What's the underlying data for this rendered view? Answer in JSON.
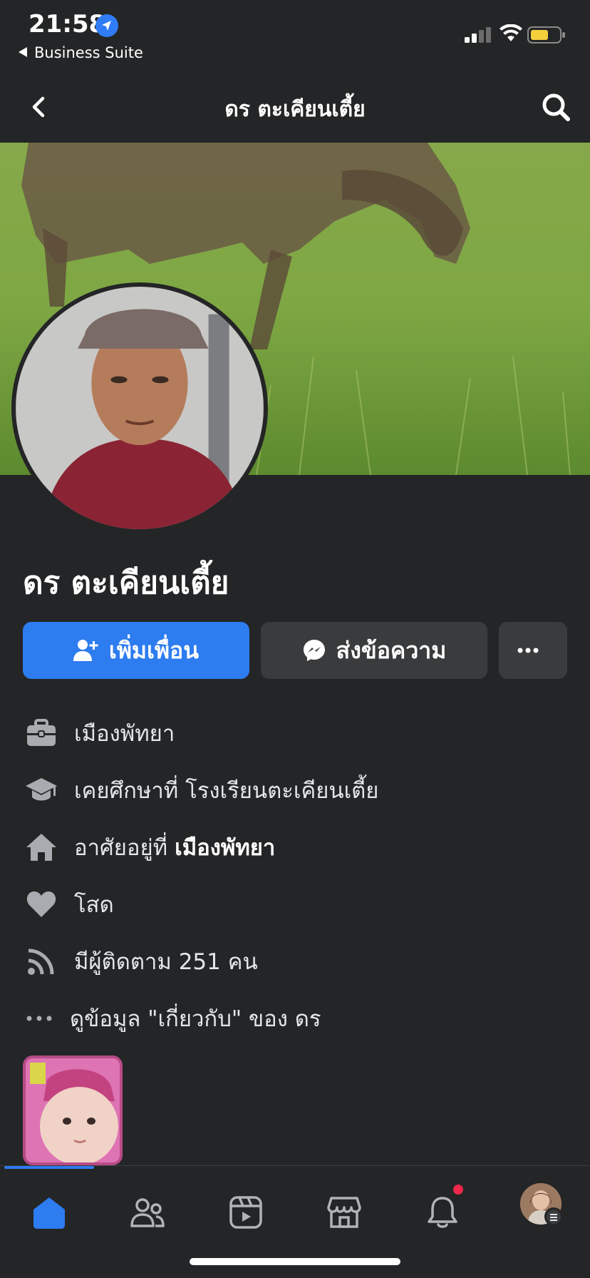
{
  "status_bar": {
    "time": "21:58",
    "back_app_label": "Business Suite"
  },
  "nav": {
    "title": "ดร ตะเคียนเตี้ย"
  },
  "profile": {
    "name": "ดร ตะเคียนเตี้ย"
  },
  "actions": {
    "add_friend_label": "เพิ่มเพื่อน",
    "message_label": "ส่งข้อความ",
    "more_label": "•••"
  },
  "info": {
    "work": "เมืองพัทยา",
    "education": "เคยศึกษาที่ โรงเรียนตะเคียนเตี้ย",
    "lives_in_prefix": "อาศัยอยู่ที่",
    "lives_in_place": "เมืองพัทยา",
    "relationship": "โสด",
    "followers": "มีผู้ติดตาม 251 คน",
    "see_about": "ดูข้อมูล \"เกี่ยวกับ\" ของ ดร"
  },
  "icons": {
    "work": "briefcase-icon",
    "education": "graduation-cap-icon",
    "home": "house-icon",
    "relationship": "heart-icon",
    "followers": "rss-icon",
    "more": "ellipsis-icon"
  },
  "colors": {
    "background": "#242526",
    "primary_button": "#2d7cf0",
    "secondary_button": "#3a3b3c",
    "notification_badge": "#f02849"
  }
}
